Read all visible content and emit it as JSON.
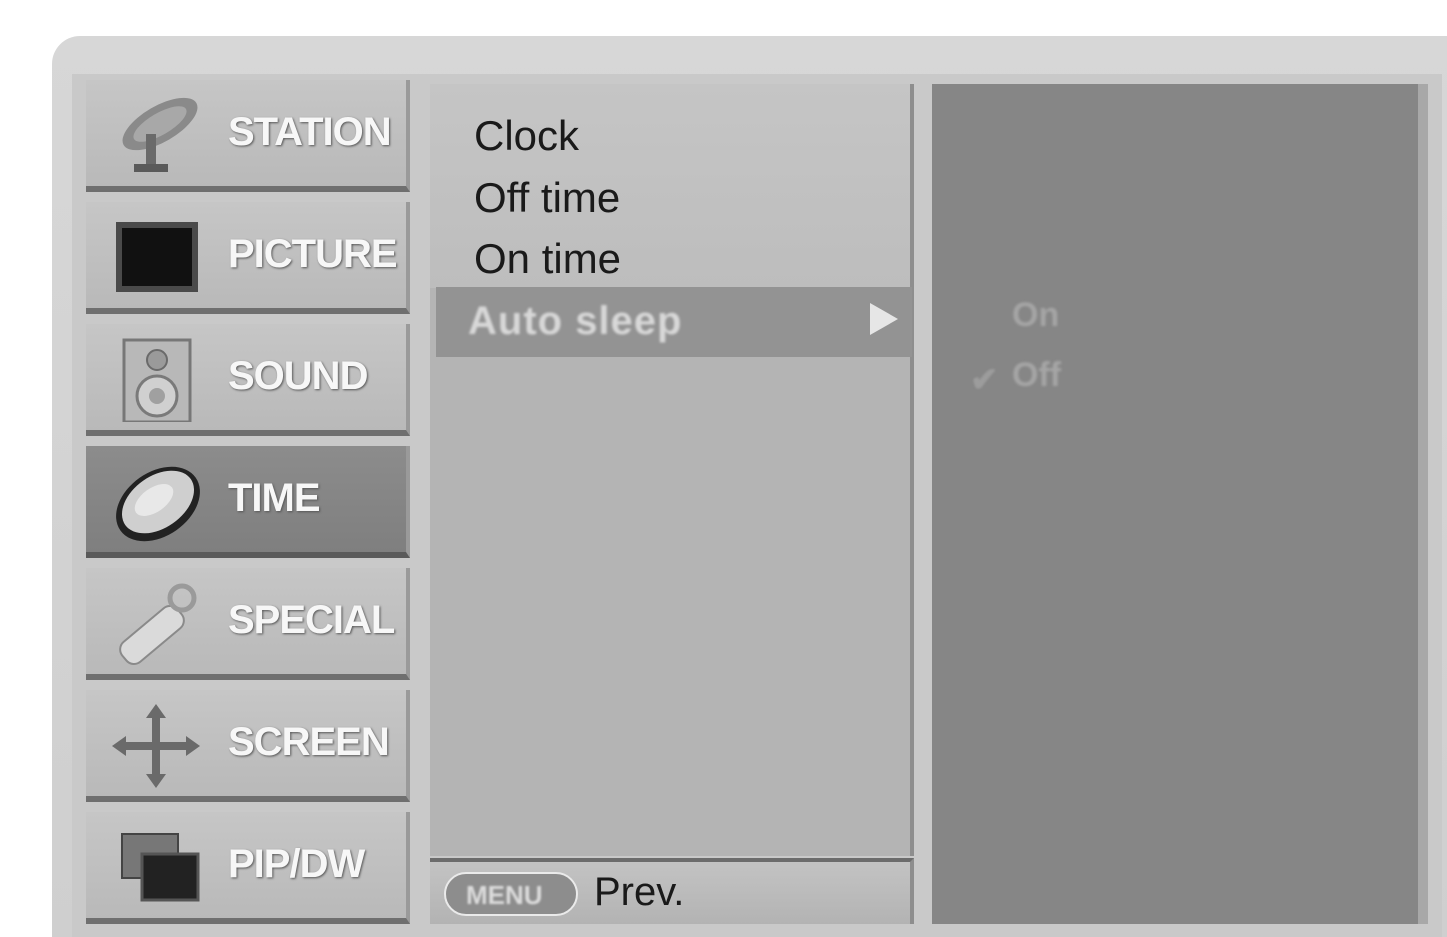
{
  "menu": {
    "items": [
      {
        "label": "STATION",
        "icon": "satellite-dish-icon",
        "selected": false
      },
      {
        "label": "PICTURE",
        "icon": "tv-screen-icon",
        "selected": false
      },
      {
        "label": "SOUND",
        "icon": "speaker-icon",
        "selected": false
      },
      {
        "label": "TIME",
        "icon": "clock-icon",
        "selected": true
      },
      {
        "label": "SPECIAL",
        "icon": "tools-icon",
        "selected": false
      },
      {
        "label": "SCREEN",
        "icon": "move-arrows-icon",
        "selected": false
      },
      {
        "label": "PIP/DW",
        "icon": "pip-windows-icon",
        "selected": false
      }
    ]
  },
  "submenu": {
    "items": [
      "Clock",
      "Off time",
      "On time"
    ],
    "highlighted": "Auto sleep"
  },
  "options": {
    "items": [
      "On",
      "Off"
    ],
    "checked": "Off"
  },
  "footer": {
    "menu_button": "MENU",
    "prev_label": "Prev."
  },
  "colors": {
    "selected_menu_bg": "#838383",
    "highlight_bg": "#939393",
    "options_bg": "#868686"
  }
}
